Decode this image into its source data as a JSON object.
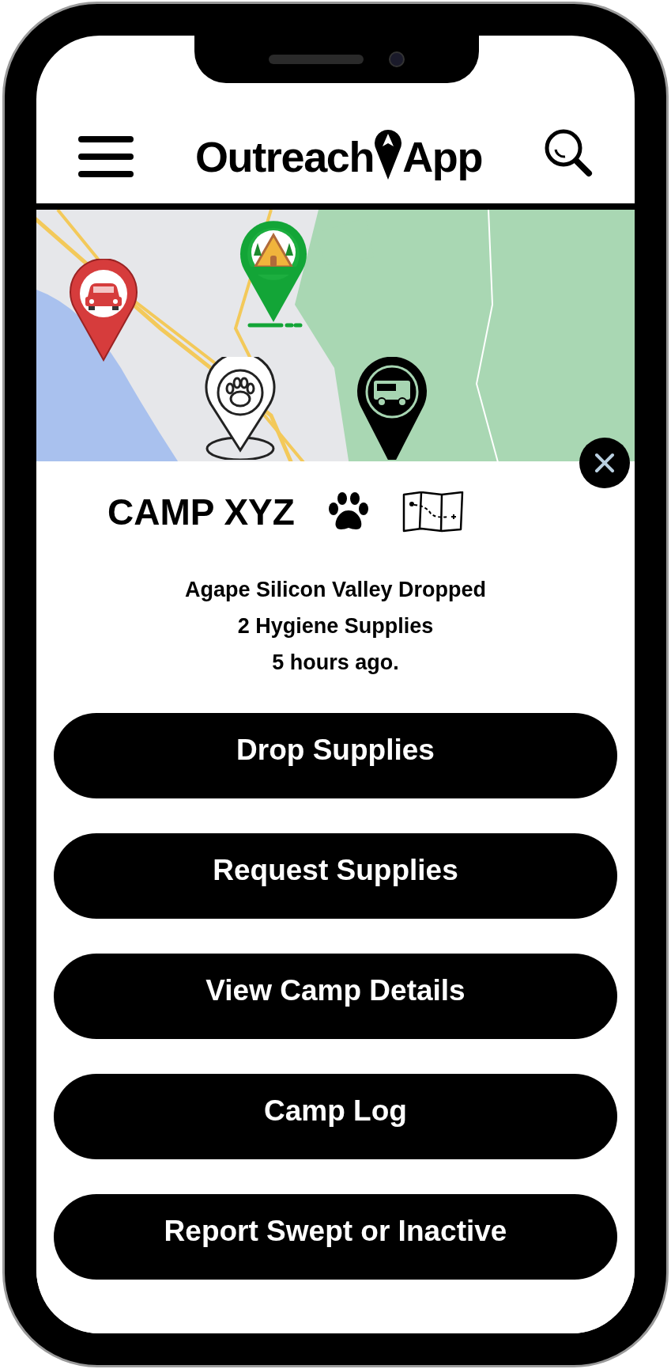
{
  "header": {
    "logo": {
      "word_1": "Outreach",
      "word_2": "App"
    }
  },
  "map": {
    "kind": "picture",
    "pins": [
      {
        "kind": "car"
      },
      {
        "kind": "camp"
      },
      {
        "kind": "pet"
      },
      {
        "kind": "food-truck"
      }
    ]
  },
  "camp_card": {
    "title": "CAMP XYZ",
    "message_lines": [
      "Agape Silicon Valley Dropped",
      "2 Hygiene Supplies",
      "5 hours ago."
    ],
    "actions": [
      "Drop Supplies",
      "Request Supplies",
      "View Camp Details",
      "Camp Log",
      "Report Swept or Inactive"
    ]
  }
}
